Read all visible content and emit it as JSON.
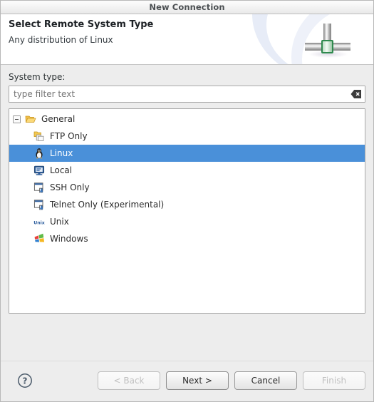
{
  "window": {
    "title": "New Connection"
  },
  "header": {
    "title": "Select Remote System Type",
    "subtitle": "Any distribution of Linux",
    "banner_icon": "network-connection-icon"
  },
  "form": {
    "system_type_label": "System type:",
    "filter": {
      "value": "",
      "placeholder": "type filter text",
      "clear_icon": "clear-text-icon"
    }
  },
  "tree": {
    "root": {
      "label": "General",
      "icon": "open-folder-icon",
      "expanded": true,
      "expander_icon": "minus-box-icon"
    },
    "items": [
      {
        "label": "FTP Only",
        "icon": "ftp-folder-icon",
        "selected": false
      },
      {
        "label": "Linux",
        "icon": "linux-penguin-icon",
        "selected": true
      },
      {
        "label": "Local",
        "icon": "local-monitor-icon",
        "selected": false
      },
      {
        "label": "SSH Only",
        "icon": "ssh-terminal-icon",
        "selected": false
      },
      {
        "label": "Telnet Only (Experimental)",
        "icon": "telnet-terminal-icon",
        "selected": false
      },
      {
        "label": "Unix",
        "icon": "unix-text-icon",
        "selected": false
      },
      {
        "label": "Windows",
        "icon": "windows-flag-icon",
        "selected": false
      }
    ]
  },
  "footer": {
    "help_icon": "help-question-icon",
    "buttons": [
      {
        "label": "< Back",
        "enabled": false
      },
      {
        "label": "Next >",
        "enabled": true
      },
      {
        "label": "Cancel",
        "enabled": true
      },
      {
        "label": "Finish",
        "enabled": false
      }
    ]
  },
  "colors": {
    "selection": "#4a90d9",
    "dialog_background": "#ededed",
    "banner_background": "#ffffff",
    "node_green": "#2f8a4e"
  }
}
